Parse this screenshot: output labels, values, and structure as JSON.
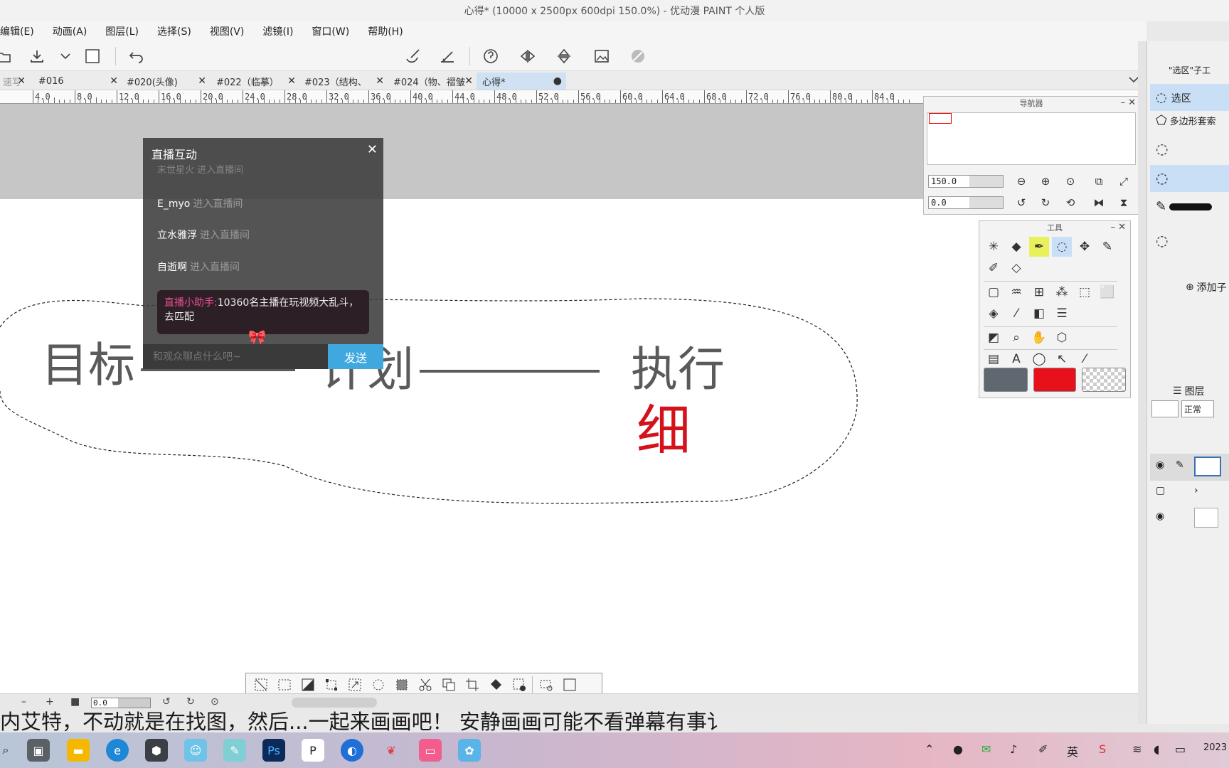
{
  "window": {
    "title": "心得* (10000 x 2500px 600dpi 150.0%)  - 优动漫 PAINT 个人版"
  },
  "menu": [
    "编辑(E)",
    "动画(A)",
    "图层(L)",
    "选择(S)",
    "视图(V)",
    "滤镜(I)",
    "窗口(W)",
    "帮助(H)"
  ],
  "tabs": [
    {
      "label": "速写"
    },
    {
      "label": "#016"
    },
    {
      "label": "#020(头像)"
    },
    {
      "label": "#022（临摹）"
    },
    {
      "label": "#023（结构、"
    },
    {
      "label": "#024（物、褶皱"
    },
    {
      "label": "心得*",
      "modified": "●"
    }
  ],
  "ruler": [
    "4.0",
    "8.0",
    "12.0",
    "16.0",
    "20.0",
    "24.0",
    "28.0",
    "32.0",
    "36.0",
    "40.0",
    "44.0",
    "48.0",
    "52.0",
    "56.0",
    "60.0",
    "64.0",
    "68.0",
    "72.0",
    "76.0",
    "80.0",
    "84.0"
  ],
  "canvas": {
    "words": [
      "目标",
      "计划",
      "执行"
    ],
    "red_word": "细"
  },
  "live": {
    "title": "直播互动",
    "faded_msg": "末世星火 进入直播间",
    "messages": [
      {
        "user": "E_myo",
        "action": "进入直播间"
      },
      {
        "user": "立水雅浮",
        "action": "进入直播间"
      },
      {
        "user": "自逝啊",
        "action": "进入直播间"
      }
    ],
    "helper_name": "直播小助手:",
    "helper_text": "10360名主播在玩视频大乱斗，去匹配",
    "input_placeholder": "和观众聊点什么吧~",
    "send_label": "发送"
  },
  "navigator": {
    "title": "导航器",
    "zoom": "150.0",
    "rotation": "0.0"
  },
  "tools_panel": {
    "title": "工具"
  },
  "colors": {
    "main": "#5f6770",
    "sub": "#e8101a",
    "accent": "#3fa9df",
    "helper_name": "#e94f93"
  },
  "right_panel": {
    "subtool_header": "\"选区\"子工",
    "items": [
      "选区",
      "多边形套索"
    ],
    "add": "添加子",
    "layer_tab": "图层",
    "blend_mode": "正常"
  },
  "status": {
    "rotation": "0.0"
  },
  "danmaku": "内艾特，不动就是在找图，然后...一起来画画吧！   安静画画可能不看弹幕有事讠",
  "taskbar": {
    "ime": "英",
    "clock": "2023"
  }
}
